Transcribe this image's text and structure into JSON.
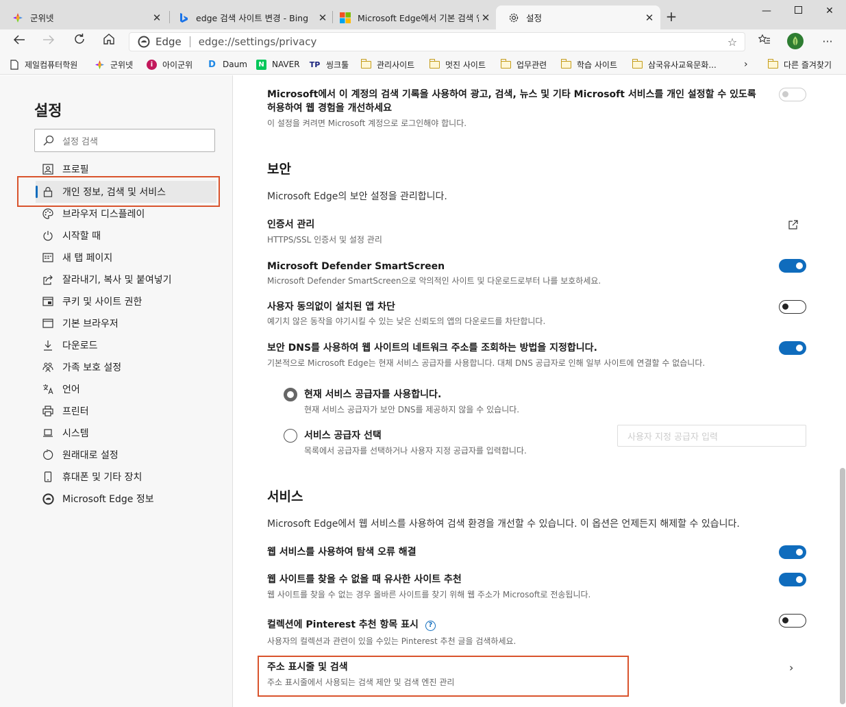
{
  "tabs": [
    {
      "title": "군위넷",
      "icon": "gunwi-favicon",
      "active": false
    },
    {
      "title": "edge 검색 사이트 변경 - Bing",
      "icon": "bing-favicon",
      "active": false
    },
    {
      "title": "Microsoft Edge에서 기본 검색 엔",
      "icon": "microsoft-favicon",
      "active": false
    },
    {
      "title": "설정",
      "icon": "gear-icon",
      "active": true
    }
  ],
  "address": {
    "brand": "Edge",
    "url": "edge://settings/privacy"
  },
  "favorites": [
    {
      "label": "제일컴퓨터학원",
      "icon": "page-icon"
    },
    {
      "label": "군위넷",
      "icon": "gunwi-favicon"
    },
    {
      "label": "아이군위",
      "icon": "igunwi-favicon"
    },
    {
      "label": "Daum",
      "icon": "daum-favicon"
    },
    {
      "label": "NAVER",
      "icon": "naver-favicon"
    },
    {
      "label": "씽크툴",
      "icon": "thinktool-favicon"
    },
    {
      "label": "관리사이트",
      "icon": "folder-icon"
    },
    {
      "label": "멋진 사이트",
      "icon": "folder-icon"
    },
    {
      "label": "업무관련",
      "icon": "folder-icon"
    },
    {
      "label": "학습 사이트",
      "icon": "folder-icon"
    },
    {
      "label": "삼국유사교육문화...",
      "icon": "folder-icon"
    }
  ],
  "other_favorites": "다른 즐겨찾기",
  "sidebar": {
    "title": "설정",
    "search_placeholder": "설정 검색",
    "items": [
      {
        "label": "프로필",
        "icon": "profile-icon"
      },
      {
        "label": "개인 정보, 검색 및 서비스",
        "icon": "lock-icon",
        "selected": true
      },
      {
        "label": "브라우저 디스플레이",
        "icon": "palette-icon"
      },
      {
        "label": "시작할 때",
        "icon": "power-icon"
      },
      {
        "label": "새 탭 페이지",
        "icon": "newtab-icon"
      },
      {
        "label": "잘라내기, 복사 및 붙여넣기",
        "icon": "share-icon"
      },
      {
        "label": "쿠키 및 사이트 권한",
        "icon": "site-permissions-icon"
      },
      {
        "label": "기본 브라우저",
        "icon": "browser-icon"
      },
      {
        "label": "다운로드",
        "icon": "download-icon"
      },
      {
        "label": "가족 보호 설정",
        "icon": "family-icon"
      },
      {
        "label": "언어",
        "icon": "language-icon"
      },
      {
        "label": "프린터",
        "icon": "printer-icon"
      },
      {
        "label": "시스템",
        "icon": "system-icon"
      },
      {
        "label": "원래대로 설정",
        "icon": "reset-icon"
      },
      {
        "label": "휴대폰 및 기타 장치",
        "icon": "phone-icon"
      },
      {
        "label": "Microsoft Edge 정보",
        "icon": "edge-icon"
      }
    ]
  },
  "main": {
    "personalize": {
      "title_line1": "Microsoft에서 이 계정의 검색 기록을 사용하여 광고, 검색, 뉴스 및 기타 Microsoft 서비스를 개인 설정할 수 있도록",
      "title_line2": "허용하여 웹 경험을 개선하세요",
      "desc": "이 설정을 켜려면 Microsoft 계정으로 로그인해야 합니다.",
      "state": "disabled"
    },
    "security": {
      "heading": "보안",
      "desc": "Microsoft Edge의 보안 설정을 관리합니다.",
      "cert": {
        "title": "인증서 관리",
        "desc": "HTTPS/SSL 인증서 및 설정 관리"
      },
      "smartscreen": {
        "title": "Microsoft Defender SmartScreen",
        "desc": "Microsoft Defender SmartScreen으로 악의적인 사이트 및 다운로드로부터 나를 보호하세요.",
        "on": true
      },
      "pua": {
        "title": "사용자 동의없이 설치된 앱 차단",
        "desc": "예기치 않은 동작을 야기시킬 수 있는 낮은 신뢰도의 앱의 다운로드를 차단합니다.",
        "on": false
      },
      "dns": {
        "title": "보안 DNS를 사용하여 웹 사이트의 네트워크 주소를 조회하는 방법을 지정합니다.",
        "desc": "기본적으로 Microsoft Edge는 현재 서비스 공급자를 사용합니다. 대체 DNS 공급자로 인해 일부 사이트에 연결할 수 없습니다.",
        "on": true
      },
      "dns_current": {
        "title": "현재 서비스 공급자를 사용합니다.",
        "desc": "현재 서비스 공급자가 보안 DNS를 제공하지 않을 수 있습니다.",
        "checked": true
      },
      "dns_choose": {
        "title": "서비스 공급자 선택",
        "desc": "목록에서 공급자를 선택하거나 사용자 지정 공급자를 입력합니다.",
        "checked": false,
        "input_placeholder": "사용자 지정 공급자 입력"
      }
    },
    "services": {
      "heading": "서비스",
      "desc": "Microsoft Edge에서 웹 서비스를 사용하여 검색 환경을 개선할 수 있습니다. 이 옵션은 언제든지 해제할 수 있습니다.",
      "nav_error": {
        "title": "웹 서비스를 사용하여 탐색 오류 해결",
        "on": true
      },
      "similar": {
        "title": "웹 사이트를 찾을 수 없을 때 유사한 사이트 추천",
        "desc": "웹 사이트를 찾을 수 없는 경우 올바른 사이트를 찾기 위해 웹 주소가 Microsoft로 전송됩니다.",
        "on": true
      },
      "pinterest": {
        "title": "컬렉션에 Pinterest 추천 항목 표시",
        "desc": "사용자의 컬렉션과 관련이 있을 수있는 Pinterest 추천 글을 검색하세요.",
        "on": false
      },
      "address_bar": {
        "title": "주소 표시줄 및 검색",
        "desc": "주소 표시줄에서 사용되는 검색 제안 및 검색 엔진 관리"
      }
    }
  }
}
